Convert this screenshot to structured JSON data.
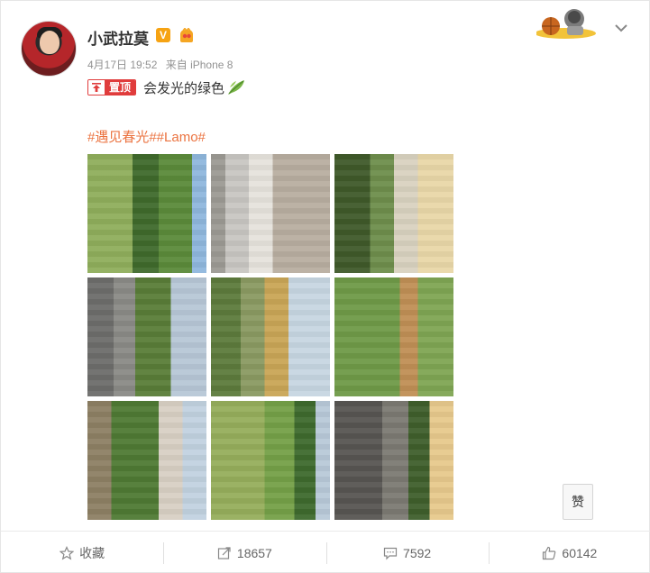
{
  "post": {
    "author": "小武拉莫",
    "verified_badge": "V",
    "time": "4月17日 19:52",
    "source": "来自 iPhone 8",
    "pinned_label": "置顶",
    "text": "会发光的绿色",
    "hashtags": "#遇见春光##Lamo#",
    "like_float": "赞"
  },
  "actions": {
    "favorite": "收藏",
    "repost_count": "18657",
    "comment_count": "7592",
    "like_count": "60142"
  },
  "icons": [
    "leaf-emoji-icon",
    "pin-icon",
    "chevron-down-icon",
    "star-icon",
    "repost-icon",
    "comment-icon",
    "thumbs-up-icon",
    "fan-badge-icon"
  ],
  "colors": {
    "hashtag": "#eb7340",
    "pin": "#e03c3c",
    "verified": "#f6a313"
  }
}
